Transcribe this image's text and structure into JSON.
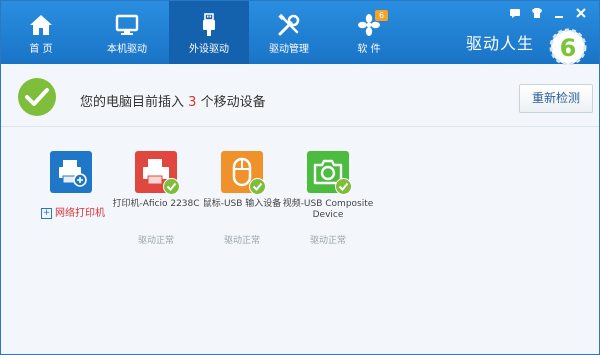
{
  "nav": {
    "tabs": [
      {
        "label": "首 页",
        "icon": "home-icon"
      },
      {
        "label": "本机驱动",
        "icon": "monitor-icon"
      },
      {
        "label": "外设驱动",
        "icon": "usb-icon"
      },
      {
        "label": "驱动管理",
        "icon": "tools-icon"
      },
      {
        "label": "软 件",
        "icon": "software-icon",
        "badge": "6"
      }
    ],
    "active_tab": "外设驱动"
  },
  "brand": {
    "name": "驱动人生",
    "logo_digit": "6"
  },
  "window_controls": [
    "feedback-icon",
    "skin-icon",
    "minimize-icon",
    "close-icon"
  ],
  "status": {
    "prefix": "您的电脑目前插入",
    "count": "3",
    "suffix": "个移动设备"
  },
  "rescan_label": "重新检测",
  "add_printer_label": "网络打印机",
  "devices": [
    {
      "name": "打印机-Aficio 2238C",
      "status": "驱动正常",
      "icon": "printer-icon",
      "color": "#e0473f"
    },
    {
      "name": "鼠标-USB 输入设备",
      "status": "驱动正常",
      "icon": "mouse-icon",
      "color": "#f0922b"
    },
    {
      "name": "视频-USB Composite Device",
      "status": "驱动正常",
      "icon": "camera-icon",
      "color": "#4cbc3f"
    }
  ],
  "colors": {
    "header": "#1d7fd1",
    "active_tab": "#1462ad",
    "accent_red": "#e0312a",
    "ok_green": "#7fbe3a",
    "add_printer_tile": "#1f77c8"
  }
}
